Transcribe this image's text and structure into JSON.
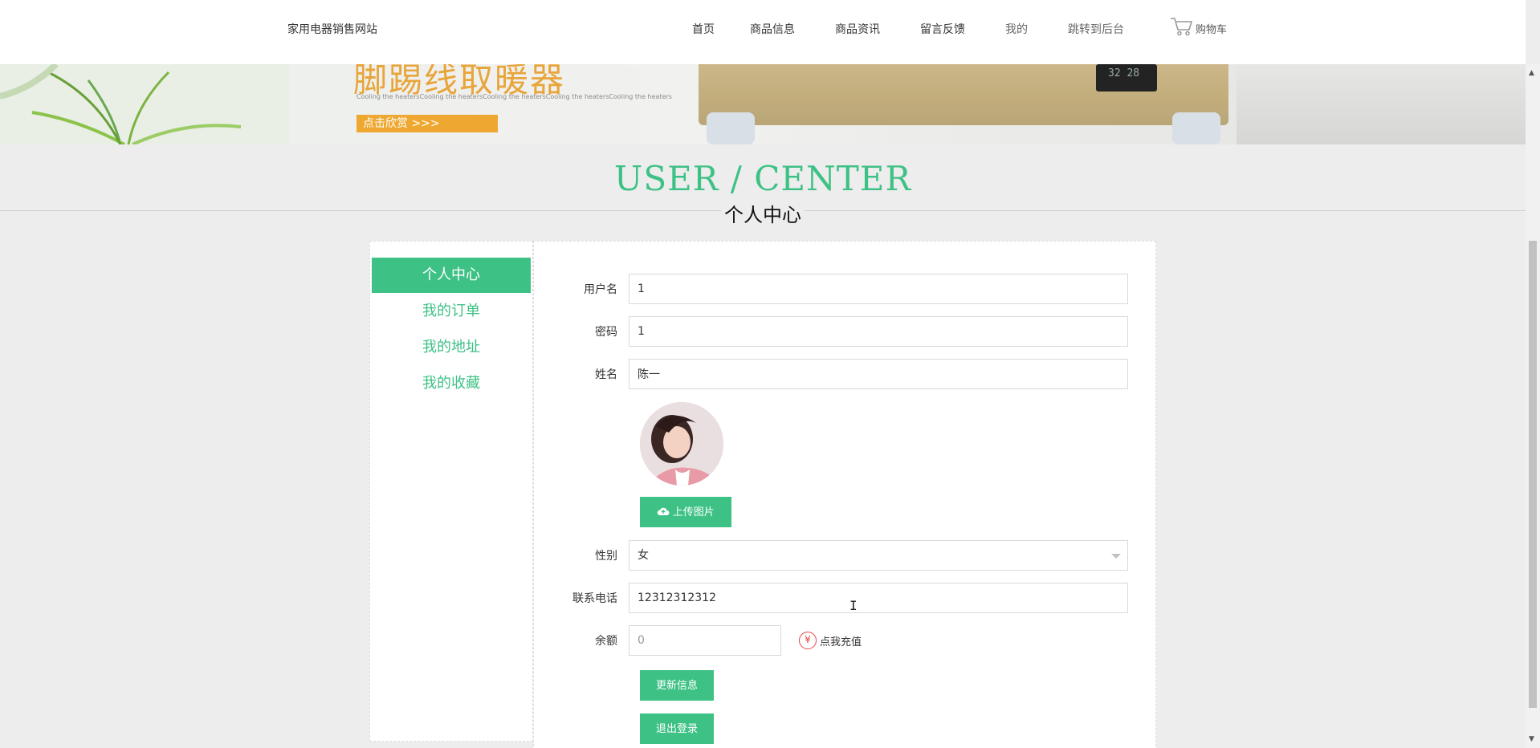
{
  "header": {
    "site_name": "家用电器销售网站",
    "nav": [
      "首页",
      "商品信息",
      "商品资讯",
      "留言反馈",
      "我的",
      "跳转到后台"
    ],
    "cart_label": "购物车"
  },
  "banner": {
    "title": "脚踢线取暖器",
    "subtitle": "Cooling the heatersCooling the heatersCooling the heatersCooling the heatersCooling the heaters",
    "button_label": "点击欣赏  >>>",
    "display_text": "32 28"
  },
  "page_title": {
    "en": "USER / CENTER",
    "cn": "个人中心"
  },
  "sidebar": {
    "items": [
      "个人中心",
      "我的订单",
      "我的地址",
      "我的收藏"
    ],
    "active_index": 0
  },
  "form": {
    "username_label": "用户名",
    "username_value": "1",
    "password_label": "密码",
    "password_value": "1",
    "name_label": "姓名",
    "name_value": "陈一",
    "upload_label": "上传图片",
    "gender_label": "性别",
    "gender_value": "女",
    "phone_label": "联系电话",
    "phone_value": "12312312312",
    "balance_label": "余额",
    "balance_value": "0",
    "recharge_icon": "¥",
    "recharge_label": "点我充值",
    "update_label": "更新信息",
    "logout_label": "退出登录"
  },
  "colors": {
    "accent": "#3ec185",
    "banner_button": "#eea831",
    "recharge_icon": "#e54343"
  },
  "icons": {
    "cart": "cart-icon",
    "upload": "cloud-upload-icon",
    "recharge": "yen-circle-icon"
  }
}
